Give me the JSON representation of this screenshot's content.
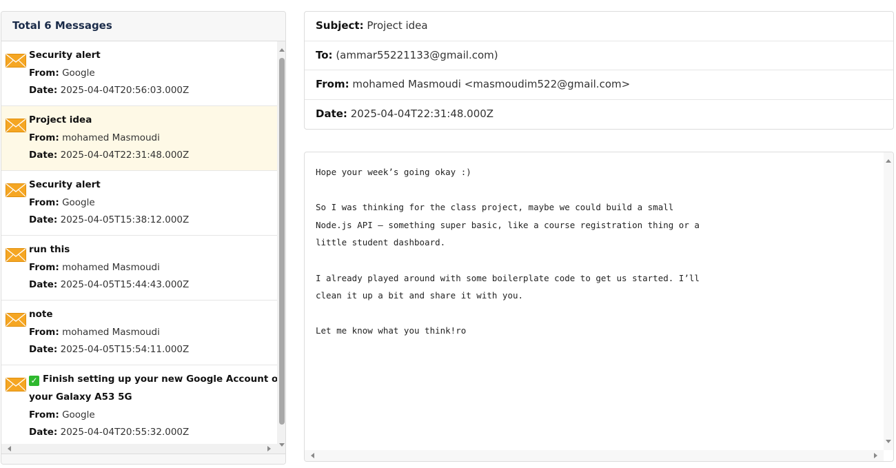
{
  "inbox": {
    "title": "Total 6 Messages",
    "from_label": "From:",
    "date_label": "Date:",
    "messages": [
      {
        "subject": "Security alert",
        "from": "Google",
        "date": "2025-04-04T20:56:03.000Z",
        "selected": false
      },
      {
        "subject": "Project idea",
        "from": "mohamed Masmoudi",
        "date": "2025-04-04T22:31:48.000Z",
        "selected": true
      },
      {
        "subject": "Security alert",
        "from": "Google",
        "date": "2025-04-05T15:38:12.000Z",
        "selected": false
      },
      {
        "subject": "run this",
        "from": "mohamed Masmoudi",
        "date": "2025-04-05T15:44:43.000Z",
        "selected": false
      },
      {
        "subject": "note",
        "from": "mohamed Masmoudi",
        "date": "2025-04-05T15:54:11.000Z",
        "selected": false
      },
      {
        "subject_line1": "Finish setting up your new Google Account on",
        "subject_line2": "your Galaxy A53 5G",
        "from": "Google",
        "date": "2025-04-04T20:55:32.000Z",
        "selected": false
      }
    ]
  },
  "detail": {
    "subject_label": "Subject:",
    "subject": "Project idea",
    "to_label": "To:",
    "to": "(ammar55221133@gmail.com)",
    "from_label": "From:",
    "from": "mohamed Masmoudi <masmoudim522@gmail.com>",
    "date_label": "Date:",
    "date": "2025-04-04T22:31:48.000Z",
    "body": "Hope your week’s going okay :)\n\nSo I was thinking for the class project, maybe we could build a small\nNode.js API — something super basic, like a course registration thing or a\nlittle student dashboard.\n\nI already played around with some boilerplate code to get us started. I’ll\nclean it up a bit and share it with you.\n\nLet me know what you think!ro"
  },
  "icons": {
    "envelope": "envelope-icon",
    "check": "check-mark-icon"
  },
  "colors": {
    "envelope": "#f5a623",
    "selected_row": "#fef9e6",
    "check_mark": "#2eb82e"
  }
}
